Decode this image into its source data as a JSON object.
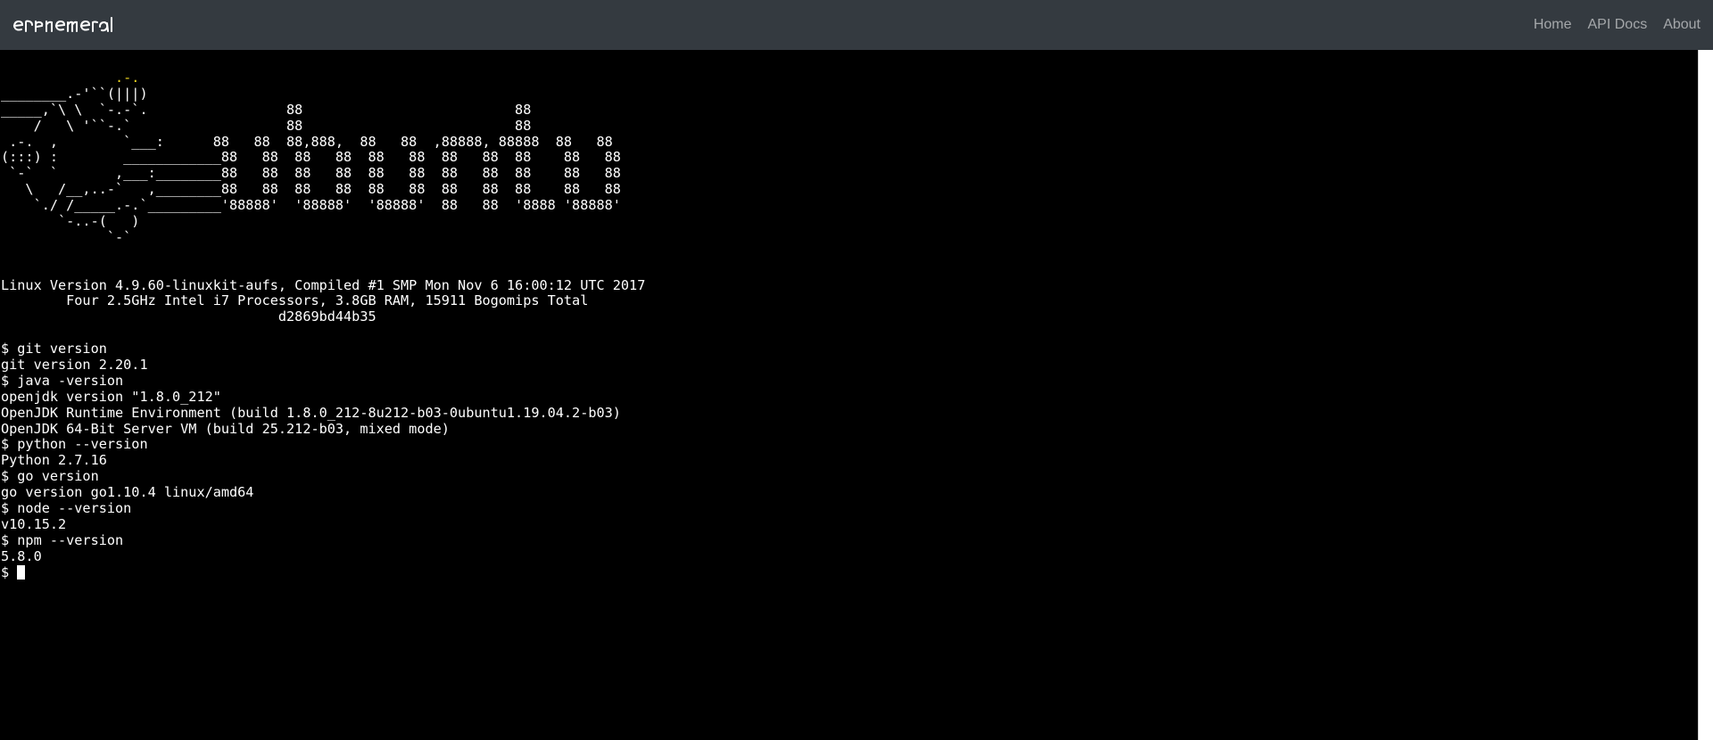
{
  "navbar": {
    "brand_text": "ephemeral",
    "links": [
      "Home",
      "API Docs",
      "About"
    ]
  },
  "terminal": {
    "logo_lines": [
      "              .-.",
      "________.-'``(|||)",
      "_____,`\\ \\  `-.-`.                 88                          88",
      "    /   \\ '``-.`                   88                          88",
      " .-.  ,        `___:      88   88  88,888,  88   88  ,88888, 88888  88   88",
      "(:::) :        ____________88   88  88   88  88   88  88   88  88    88   88",
      " `-`  `       ,___:________88   88  88   88  88   88  88   88  88    88   88",
      "   \\   /__,..-`   ,________88   88  88   88  88   88  88   88  88    88   88",
      "    `./ /_____.-.`_________'88888'  '88888'  '88888'  88   88  '8888 '88888'",
      "       `-..-(   )",
      "             `-`"
    ],
    "system_info": [
      "Linux Version 4.9.60-linuxkit-aufs, Compiled #1 SMP Mon Nov 6 16:00:12 UTC 2017",
      "        Four 2.5GHz Intel i7 Processors, 3.8GB RAM, 15911 Bogomips Total",
      "                                  d2869bd44b35"
    ],
    "session": [
      "$ git version",
      "git version 2.20.1",
      "$ java -version",
      "openjdk version \"1.8.0_212\"",
      "OpenJDK Runtime Environment (build 1.8.0_212-8u212-b03-0ubuntu1.19.04.2-b03)",
      "OpenJDK 64-Bit Server VM (build 25.212-b03, mixed mode)",
      "$ python --version",
      "Python 2.7.16",
      "$ go version",
      "go version go1.10.4 linux/amd64",
      "$ node --version",
      "v10.15.2",
      "$ npm --version",
      "5.8.0"
    ],
    "prompt": "$ ",
    "colors": {
      "background": "#000000",
      "text": "#ffffff",
      "logo_accent": "#e8d21f"
    }
  }
}
